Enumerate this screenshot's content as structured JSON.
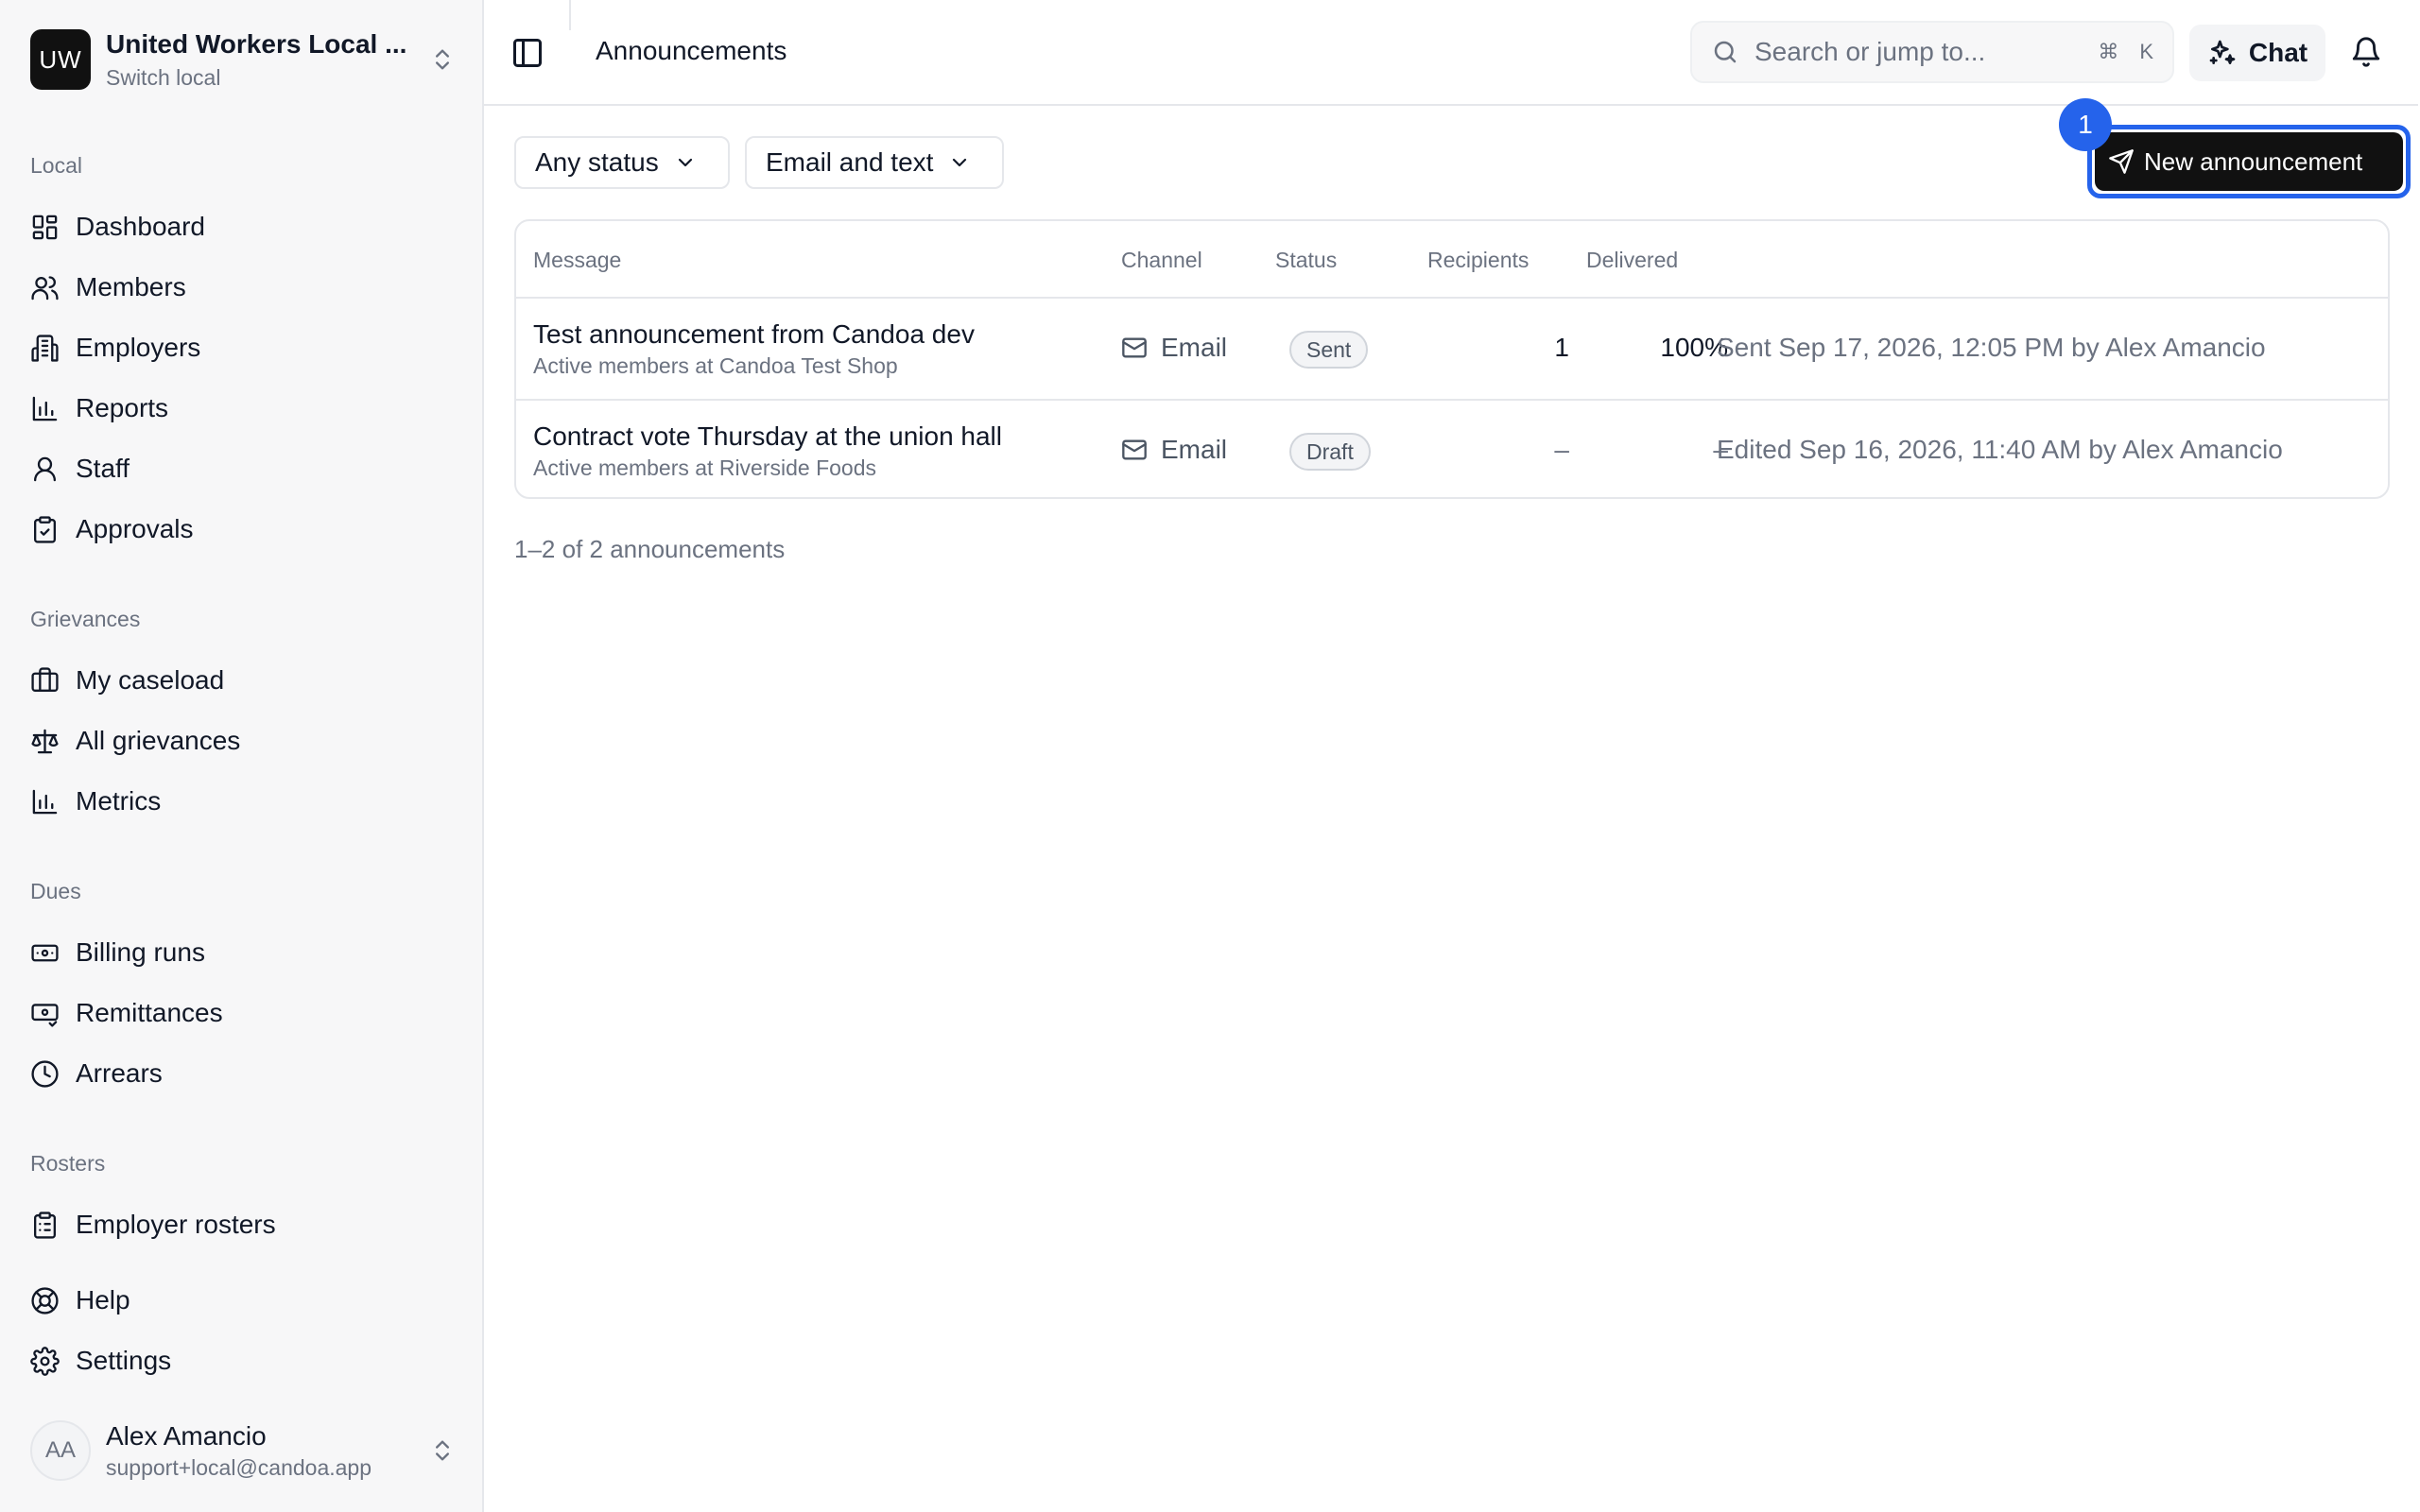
{
  "org": {
    "initials": "UW",
    "name": "United Workers Local ...",
    "switch_label": "Switch local"
  },
  "sections": {
    "local": "Local",
    "grievances": "Grievances",
    "dues": "Dues",
    "rosters": "Rosters"
  },
  "nav": {
    "dashboard": "Dashboard",
    "members": "Members",
    "employers": "Employers",
    "reports": "Reports",
    "staff": "Staff",
    "approvals": "Approvals",
    "my_caseload": "My caseload",
    "all_grievances": "All grievances",
    "metrics": "Metrics",
    "billing_runs": "Billing runs",
    "remittances": "Remittances",
    "arrears": "Arrears",
    "employer_rosters": "Employer rosters",
    "help": "Help",
    "settings": "Settings"
  },
  "user": {
    "initials": "AA",
    "name": "Alex Amancio",
    "email": "support+local@candoa.app"
  },
  "header": {
    "title": "Announcements",
    "search_placeholder": "Search or jump to...",
    "kbd_cmd": "⌘",
    "kbd_key": "K",
    "chat_label": "Chat"
  },
  "filters": {
    "status": "Any status",
    "channel": "Email and text"
  },
  "new_button": {
    "label": "New announcement",
    "badge": "1"
  },
  "table": {
    "headers": {
      "message": "Message",
      "channel": "Channel",
      "status": "Status",
      "recipients": "Recipients",
      "delivered": "Delivered"
    },
    "rows": [
      {
        "title": "Test announcement from Candoa dev",
        "audience": "Active members at Candoa Test Shop",
        "channel": "Email",
        "status": "Sent",
        "recipients": "1",
        "delivered": "100%",
        "event": "Sent Sep 17, 2026, 12:05 PM by Alex Amancio"
      },
      {
        "title": "Contract vote Thursday at the union hall",
        "audience": "Active members at Riverside Foods",
        "channel": "Email",
        "status": "Draft",
        "recipients": "–",
        "delivered": "–",
        "event": "Edited Sep 16, 2026, 11:40 AM by Alex Amancio"
      }
    ]
  },
  "footer_count": "1–2 of 2 announcements",
  "colors": {
    "accent": "#2563eb",
    "primary_button": "#111111",
    "sidebar_bg": "#f7f7f8"
  }
}
